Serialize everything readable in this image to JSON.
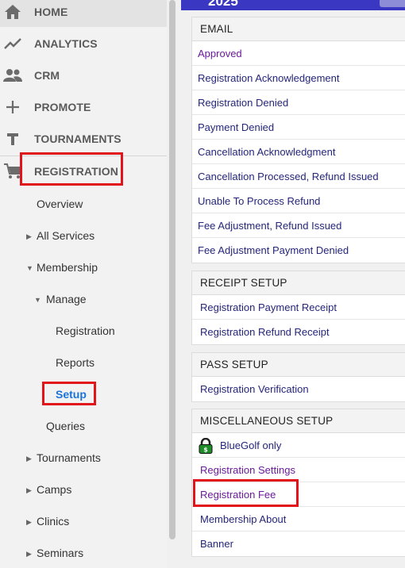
{
  "sidebar": {
    "nav": [
      {
        "icon": "home-icon",
        "label": "HOME"
      },
      {
        "icon": "trending-icon",
        "label": "ANALYTICS"
      },
      {
        "icon": "people-icon",
        "label": "CRM"
      },
      {
        "icon": "plus-icon",
        "label": "PROMOTE"
      },
      {
        "icon": "tournament-t-icon",
        "label": "TOURNAMENTS"
      },
      {
        "icon": "cart-icon",
        "label": "REGISTRATION"
      }
    ],
    "sub": {
      "overview": "Overview",
      "all_services": "All Services",
      "membership": "Membership",
      "manage": "Manage",
      "registration": "Registration",
      "reports": "Reports",
      "setup": "Setup",
      "queries": "Queries",
      "tournaments": "Tournaments",
      "camps": "Camps",
      "clinics": "Clinics",
      "seminars": "Seminars"
    }
  },
  "header": {
    "year": "2025"
  },
  "email": {
    "title": "EMAIL",
    "items": [
      "Approved",
      "Registration Acknowledgement",
      "Registration Denied",
      "Payment Denied",
      "Cancellation Acknowledgment",
      "Cancellation Processed, Refund Issued",
      "Unable To Process Refund",
      "Fee Adjustment, Refund Issued",
      "Fee Adjustment Payment Denied"
    ]
  },
  "receipt": {
    "title": "RECEIPT SETUP",
    "items": [
      "Registration Payment Receipt",
      "Registration Refund Receipt"
    ]
  },
  "pass": {
    "title": "PASS SETUP",
    "items": [
      "Registration Verification"
    ]
  },
  "misc": {
    "title": "MISCELLANEOUS SETUP",
    "bluegolf_only": "BlueGolf only",
    "items": [
      "Registration Settings",
      "Registration Fee",
      "Membership About",
      "Banner"
    ]
  },
  "colors": {
    "accent": "#3a37c3",
    "highlight": "#e1141b",
    "link_purple": "#6a1a9a",
    "link_navy": "#25257a",
    "active": "#1a73d8"
  }
}
